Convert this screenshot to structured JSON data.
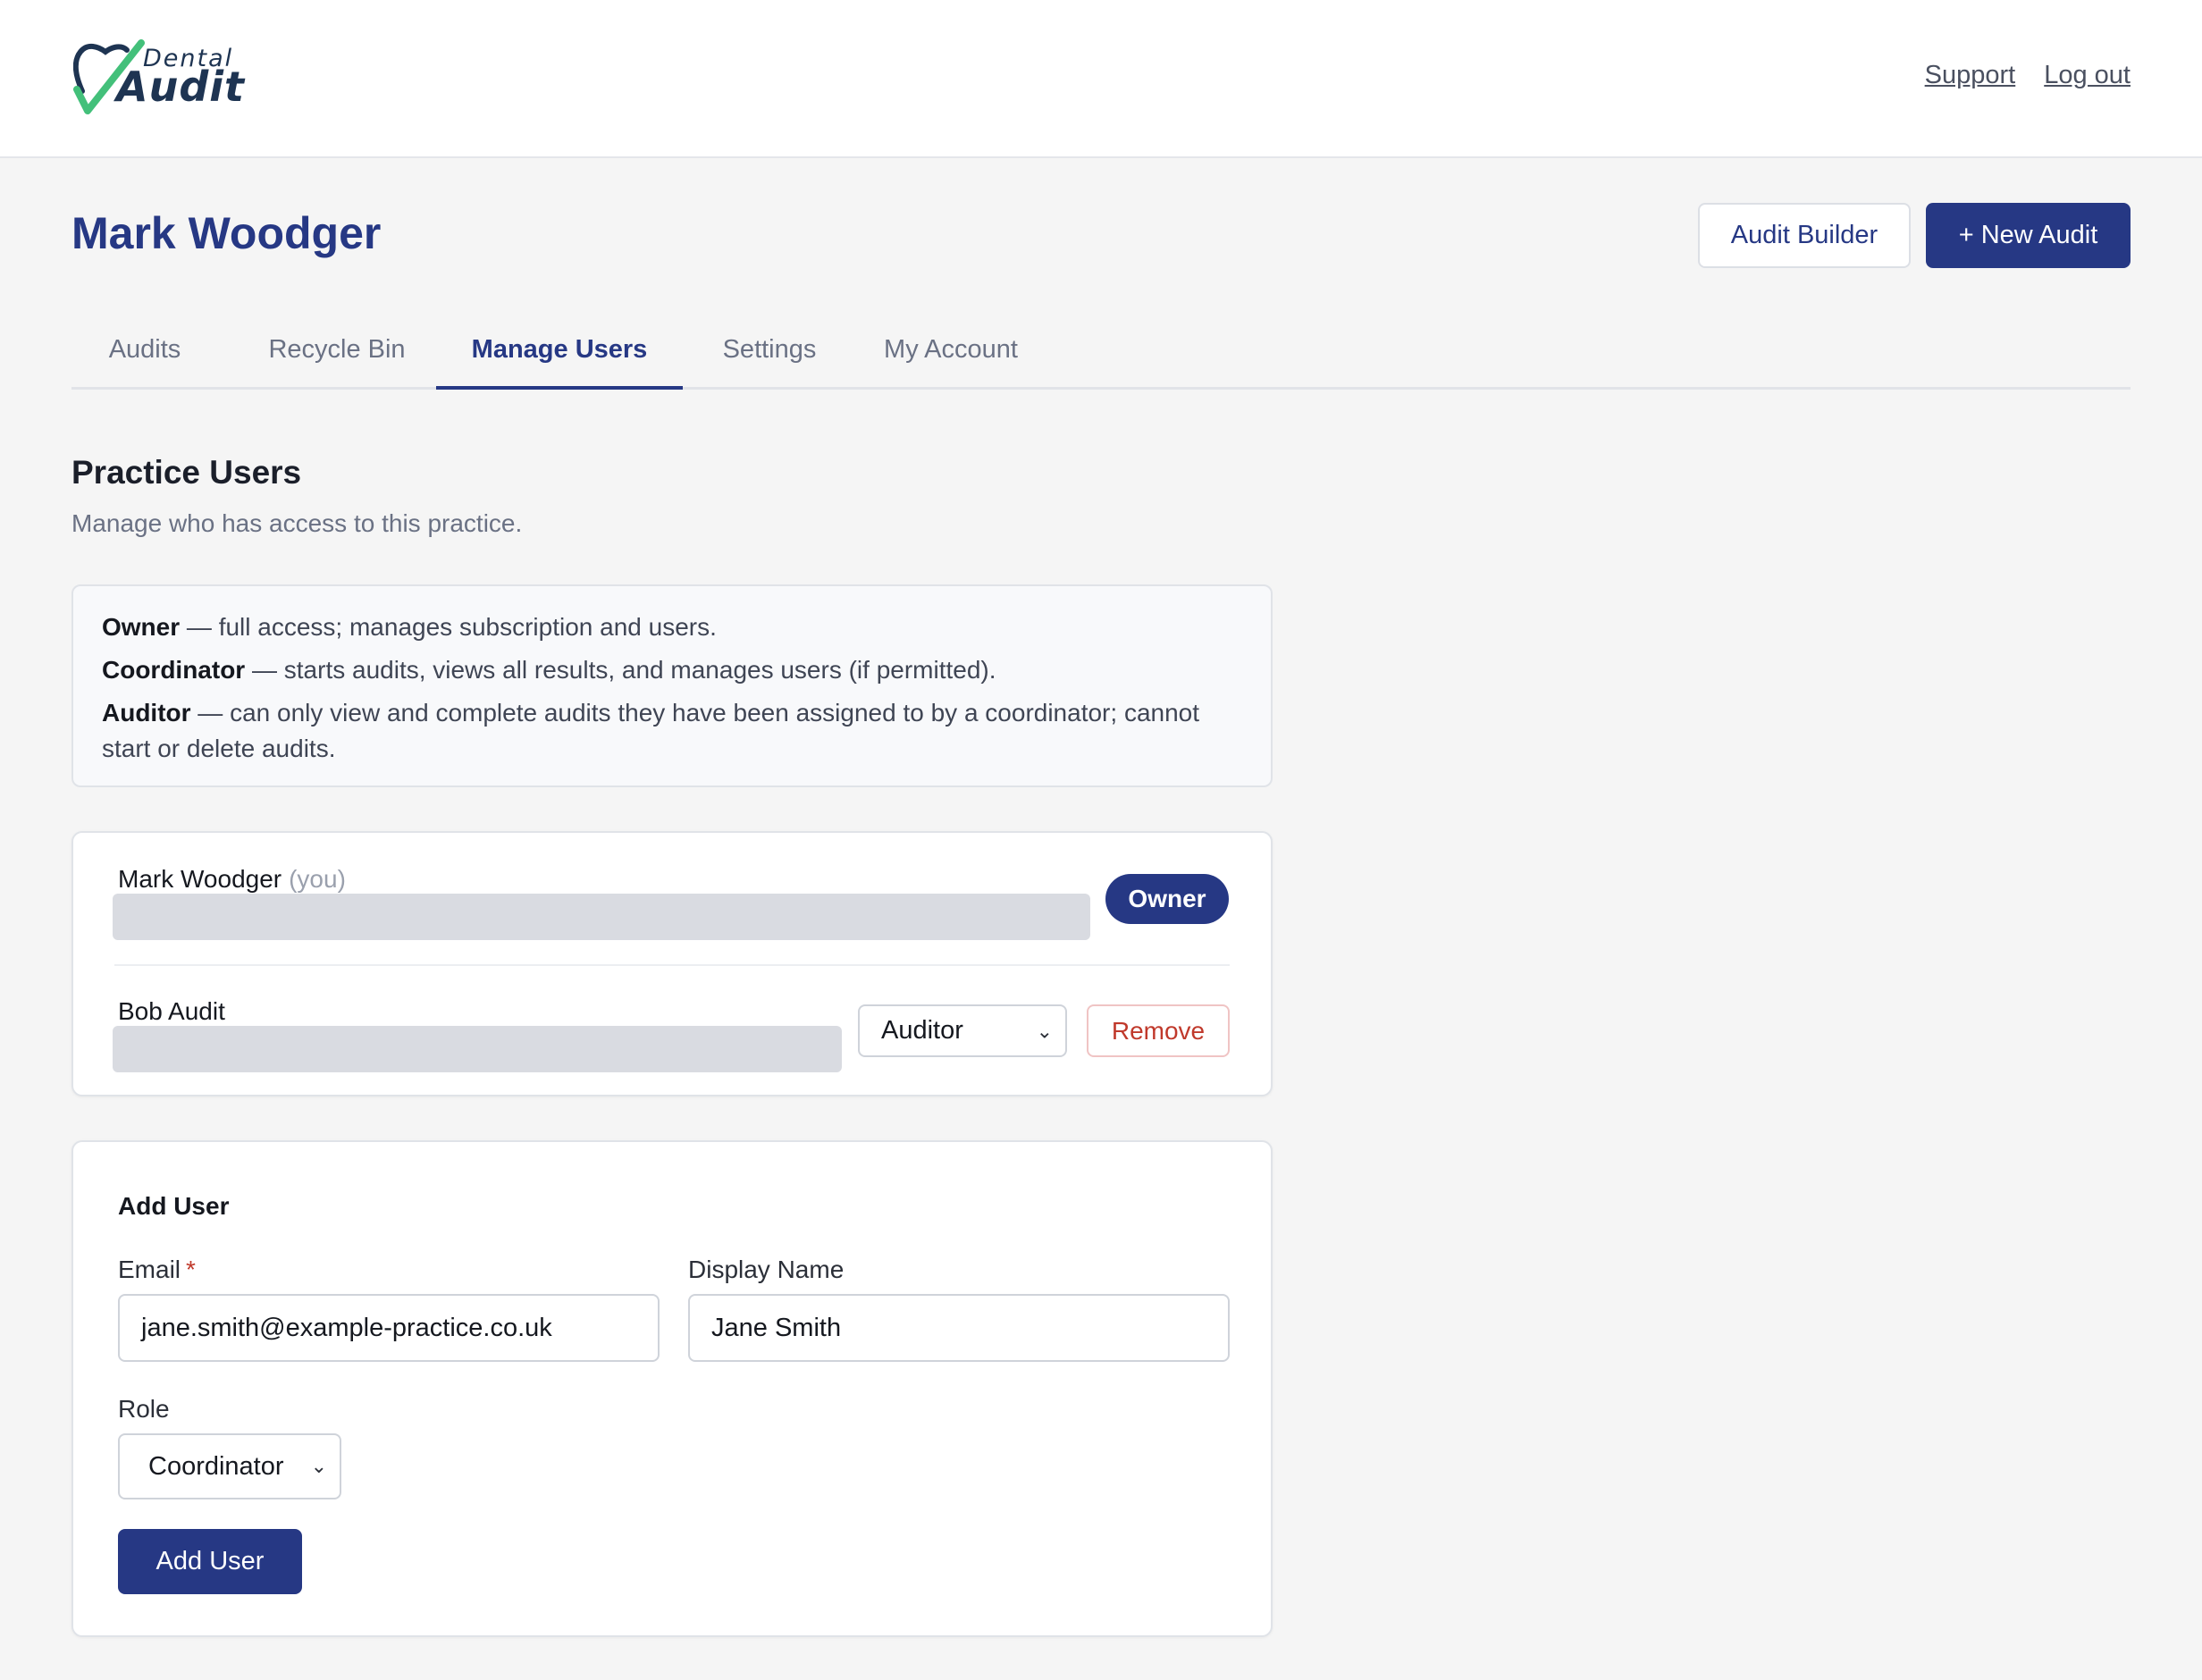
{
  "logo": {
    "small_text": "Dental",
    "large_text": "Audit",
    "brand_color": "#1e3452",
    "check_color": "#43c07a"
  },
  "header_links": {
    "support": "Support",
    "logout": "Log out"
  },
  "page": {
    "title": "Mark Woodger"
  },
  "actions": {
    "audit_builder": "Audit Builder",
    "new_audit": "+ New Audit"
  },
  "tabs": [
    {
      "label": "Audits",
      "active": false
    },
    {
      "label": "Recycle Bin",
      "active": false
    },
    {
      "label": "Manage Users",
      "active": true
    },
    {
      "label": "Settings",
      "active": false
    },
    {
      "label": "My Account",
      "active": false
    }
  ],
  "section": {
    "title": "Practice Users",
    "subtitle": "Manage who has access to this practice."
  },
  "roles_info": [
    {
      "role": "Owner",
      "desc": " — full access; manages subscription and users."
    },
    {
      "role": "Coordinator",
      "desc": " — starts audits, views all results, and manages users (if permitted)."
    },
    {
      "role": "Auditor",
      "desc": " — can only view and complete audits they have been assigned to by a coordinator; cannot start or delete audits."
    }
  ],
  "users": [
    {
      "name": "Mark Woodger",
      "tag": "(you)",
      "badge": "Owner"
    },
    {
      "name": "Bob Audit",
      "role_value": "Auditor",
      "remove_label": "Remove"
    }
  ],
  "add_user": {
    "title": "Add User",
    "email_label": "Email",
    "required_mark": "*",
    "email_value": "jane.smith@example-practice.co.uk",
    "display_name_label": "Display Name",
    "display_name_value": "Jane Smith",
    "role_label": "Role",
    "role_value": "Coordinator",
    "submit_label": "Add User"
  },
  "colors": {
    "primary": "#263884",
    "danger": "#c0392b",
    "background": "#f5f5f5"
  }
}
